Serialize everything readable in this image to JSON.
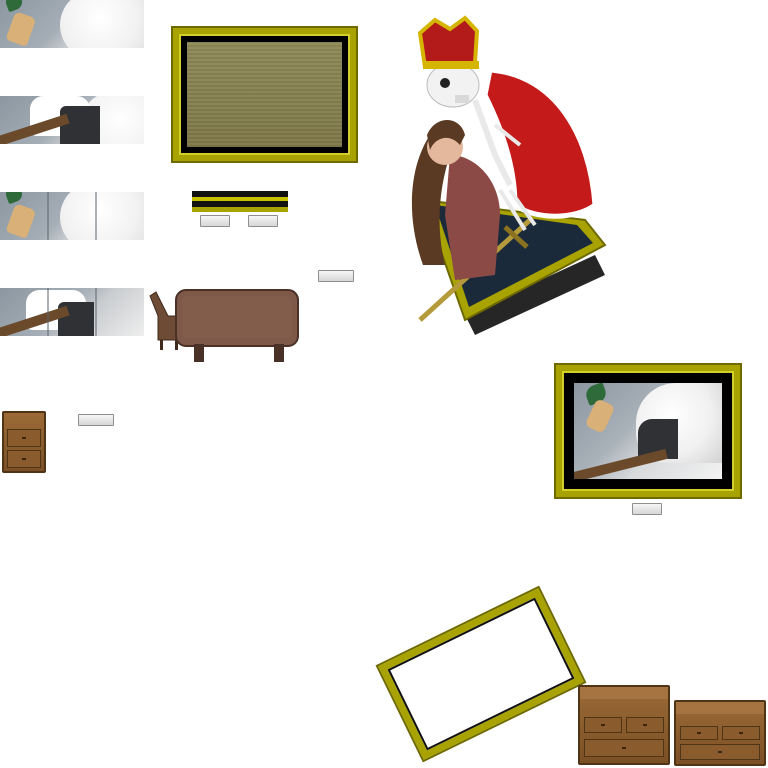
{
  "sheet": {
    "width": 768,
    "height": 768,
    "background": "#ffffff",
    "accent_gold": "#a8a300",
    "wood_brown": "#7b5025",
    "robe_red": "#c41a1a"
  },
  "buttons": {
    "b1": {
      "label": "",
      "icon": "blank-button"
    },
    "b2": {
      "label": "",
      "icon": "button-face"
    },
    "b3": {
      "label": "",
      "icon": "button-face"
    },
    "b4": {
      "label": "",
      "icon": "blank-button"
    },
    "b5": {
      "label": "",
      "icon": "button-face"
    }
  },
  "tiles": [
    {
      "name": "painting-tile-leaf-hand",
      "icon": "leaf-icon"
    },
    {
      "name": "painting-tile-sleeve",
      "icon": "sleeve-icon"
    },
    {
      "name": "painting-tile-split-3",
      "icon": "split-tiles-icon"
    },
    {
      "name": "painting-tile-split-4",
      "icon": "split-tiles-icon"
    }
  ],
  "objects": {
    "frame_large_empty": {
      "icon": "picture-frame-icon"
    },
    "frame_with_painting": {
      "icon": "picture-frame-icon"
    },
    "frame_tilted": {
      "icon": "picture-frame-icon"
    },
    "stripe_swatch": {
      "icon": "color-swatch-icon"
    },
    "dining_table": {
      "icon": "table-chair-icon"
    },
    "nightstand": {
      "icon": "nightstand-icon"
    },
    "dresser_left": {
      "icon": "dresser-icon"
    },
    "dresser_right": {
      "icon": "dresser-icon"
    },
    "king_skeleton_scene": {
      "icon": "skeleton-king-icon"
    }
  }
}
